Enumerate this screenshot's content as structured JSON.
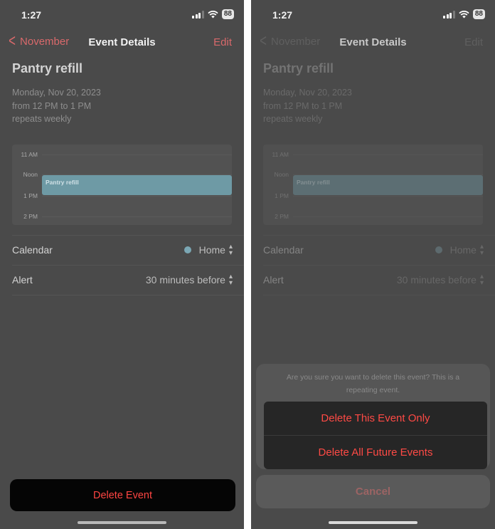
{
  "status": {
    "time": "1:27",
    "battery": "88"
  },
  "nav": {
    "back_label": "November",
    "title": "Event Details",
    "edit_label": "Edit"
  },
  "event": {
    "title": "Pantry refill",
    "date": "Monday, Nov 20, 2023",
    "time_range": "from 12 PM to 1 PM",
    "repeat": "repeats weekly"
  },
  "timeline": {
    "hours": [
      "11 AM",
      "Noon",
      "1 PM",
      "2 PM"
    ],
    "event_label": "Pantry refill"
  },
  "details": {
    "calendar_label": "Calendar",
    "calendar_value": "Home",
    "calendar_color": "#7ba7b4",
    "alert_label": "Alert",
    "alert_value": "30 minutes before"
  },
  "delete_button_label": "Delete Event",
  "action_sheet": {
    "message": "Are you sure you want to delete this event? This is a repeating event.",
    "option_this": "Delete This Event Only",
    "option_future": "Delete All Future Events",
    "cancel": "Cancel"
  },
  "colors": {
    "destructive": "#ff4542",
    "accent": "#d9696b"
  }
}
